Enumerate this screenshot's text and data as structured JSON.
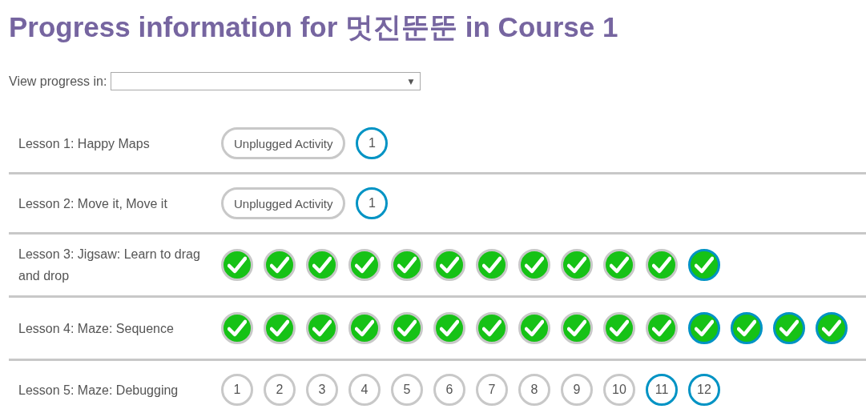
{
  "title": "Progress information for 멋진뚠뚠 in Course 1",
  "view_progress": {
    "label": "View progress in:",
    "caret": "▼"
  },
  "lessons": [
    {
      "name": "Lesson 1: Happy Maps",
      "bubbles": [
        {
          "kind": "unplugged",
          "text": "Unplugged Activity",
          "highlighted": false
        },
        {
          "kind": "number",
          "text": "1",
          "highlighted": true
        }
      ]
    },
    {
      "name": "Lesson 2: Move it, Move it",
      "bubbles": [
        {
          "kind": "unplugged",
          "text": "Unplugged Activity",
          "highlighted": false
        },
        {
          "kind": "number",
          "text": "1",
          "highlighted": true
        }
      ]
    },
    {
      "name": "Lesson 3: Jigsaw: Learn to drag and drop",
      "bubbles": [
        {
          "kind": "done",
          "highlighted": false
        },
        {
          "kind": "done",
          "highlighted": false
        },
        {
          "kind": "done",
          "highlighted": false
        },
        {
          "kind": "done",
          "highlighted": false
        },
        {
          "kind": "done",
          "highlighted": false
        },
        {
          "kind": "done",
          "highlighted": false
        },
        {
          "kind": "done",
          "highlighted": false
        },
        {
          "kind": "done",
          "highlighted": false
        },
        {
          "kind": "done",
          "highlighted": false
        },
        {
          "kind": "done",
          "highlighted": false
        },
        {
          "kind": "done",
          "highlighted": false
        },
        {
          "kind": "done",
          "highlighted": true
        }
      ]
    },
    {
      "name": "Lesson 4: Maze: Sequence",
      "bubbles": [
        {
          "kind": "done",
          "highlighted": false
        },
        {
          "kind": "done",
          "highlighted": false
        },
        {
          "kind": "done",
          "highlighted": false
        },
        {
          "kind": "done",
          "highlighted": false
        },
        {
          "kind": "done",
          "highlighted": false
        },
        {
          "kind": "done",
          "highlighted": false
        },
        {
          "kind": "done",
          "highlighted": false
        },
        {
          "kind": "done",
          "highlighted": false
        },
        {
          "kind": "done",
          "highlighted": false
        },
        {
          "kind": "done",
          "highlighted": false
        },
        {
          "kind": "done",
          "highlighted": false
        },
        {
          "kind": "done",
          "highlighted": true
        },
        {
          "kind": "done",
          "highlighted": true
        },
        {
          "kind": "done",
          "highlighted": true
        },
        {
          "kind": "done",
          "highlighted": true
        }
      ]
    },
    {
      "name": "Lesson 5: Maze: Debugging",
      "bubbles": [
        {
          "kind": "number",
          "text": "1",
          "highlighted": false
        },
        {
          "kind": "number",
          "text": "2",
          "highlighted": false
        },
        {
          "kind": "number",
          "text": "3",
          "highlighted": false
        },
        {
          "kind": "number",
          "text": "4",
          "highlighted": false
        },
        {
          "kind": "number",
          "text": "5",
          "highlighted": false
        },
        {
          "kind": "number",
          "text": "6",
          "highlighted": false
        },
        {
          "kind": "number",
          "text": "7",
          "highlighted": false
        },
        {
          "kind": "number",
          "text": "8",
          "highlighted": false
        },
        {
          "kind": "number",
          "text": "9",
          "highlighted": false
        },
        {
          "kind": "number",
          "text": "10",
          "highlighted": false
        },
        {
          "kind": "number",
          "text": "11",
          "highlighted": true
        },
        {
          "kind": "number",
          "text": "12",
          "highlighted": true
        }
      ]
    }
  ]
}
